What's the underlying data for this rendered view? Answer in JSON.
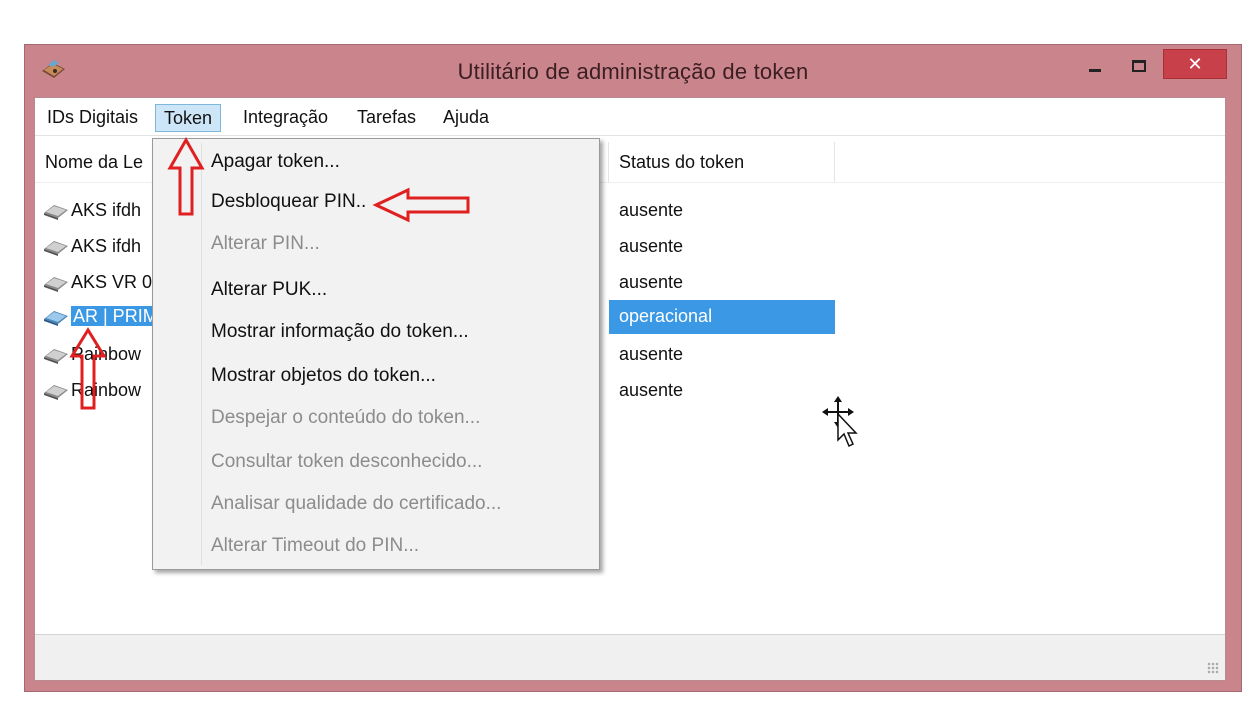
{
  "window": {
    "title": "Utilitário de administração de token",
    "close_glyph": "✕"
  },
  "menubar": {
    "items": [
      "IDs Digitais",
      "Token",
      "Integração",
      "Tarefas",
      "Ajuda"
    ],
    "active_index": 1
  },
  "list": {
    "columns": [
      "Nome da Le",
      "Status do token"
    ],
    "rows": [
      {
        "name": "AKS ifdh",
        "status": "ausente",
        "selected": false
      },
      {
        "name": "AKS ifdh",
        "status": "ausente",
        "selected": false
      },
      {
        "name": "AKS VR 0",
        "status": "ausente",
        "selected": false
      },
      {
        "name": "AR | PRIM",
        "status": "operacional",
        "selected": true
      },
      {
        "name": "Rainbow",
        "status": "ausente",
        "selected": false
      },
      {
        "name": "Rainbow",
        "status": "ausente",
        "selected": false
      }
    ]
  },
  "token_menu": {
    "items": [
      {
        "label": "Apagar token...",
        "enabled": true
      },
      {
        "label": "Desbloquear PIN..",
        "enabled": true
      },
      {
        "label": "Alterar PIN...",
        "enabled": false
      },
      {
        "label": "Alterar PUK...",
        "enabled": true
      },
      {
        "label": "Mostrar informação do token...",
        "enabled": true
      },
      {
        "label": "Mostrar objetos do token...",
        "enabled": true
      },
      {
        "label": "Despejar o conteúdo do token...",
        "enabled": false
      },
      {
        "label": "Consultar token desconhecido...",
        "enabled": false
      },
      {
        "label": "Analisar qualidade do certificado...",
        "enabled": false
      },
      {
        "label": "Alterar Timeout do PIN...",
        "enabled": false
      }
    ]
  },
  "annotations": {
    "arrow_color": "#e02020",
    "icons": [
      "arrow-up-icon",
      "arrow-left-icon",
      "arrow-up-icon"
    ]
  },
  "colors": {
    "selection": "#3a98e4",
    "titlebar": "#c9848c",
    "close_button": "#c8404a"
  }
}
